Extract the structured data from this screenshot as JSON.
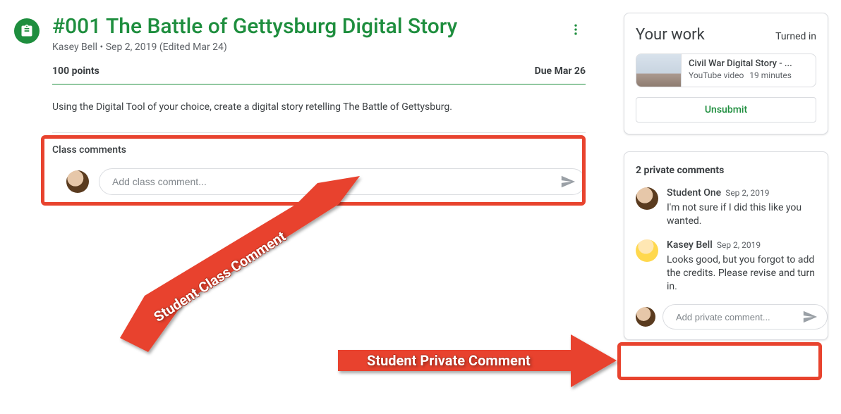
{
  "assignment": {
    "title": "#001 The Battle of Gettysburg Digital Story",
    "author": "Kasey Bell",
    "posted": "Sep 2, 2019",
    "edited": "(Edited Mar 24)",
    "points": "100 points",
    "due": "Due Mar 26",
    "description": "Using the Digital Tool of your choice, create a digital story retelling The Battle of Gettysburg."
  },
  "classComments": {
    "heading": "Class comments",
    "placeholder": "Add class comment..."
  },
  "yourWork": {
    "heading": "Your work",
    "status": "Turned in",
    "attachment": {
      "title": "Civil War Digital Story - ...",
      "kind": "YouTube video",
      "duration": "19 minutes"
    },
    "unsubmitLabel": "Unsubmit"
  },
  "privateComments": {
    "heading": "2 private comments",
    "items": [
      {
        "name": "Student One",
        "date": "Sep 2, 2019",
        "text": "I'm not sure if I did this like you wanted.",
        "avatar": "student"
      },
      {
        "name": "Kasey Bell",
        "date": "Sep 2, 2019",
        "text": "Looks good, but you forgot to add the credits. Please revise and turn in.",
        "avatar": "teacher"
      }
    ],
    "placeholder": "Add private comment..."
  },
  "annotations": {
    "classLabel": "Student Class Comment",
    "privateLabel": "Student Private Comment"
  }
}
